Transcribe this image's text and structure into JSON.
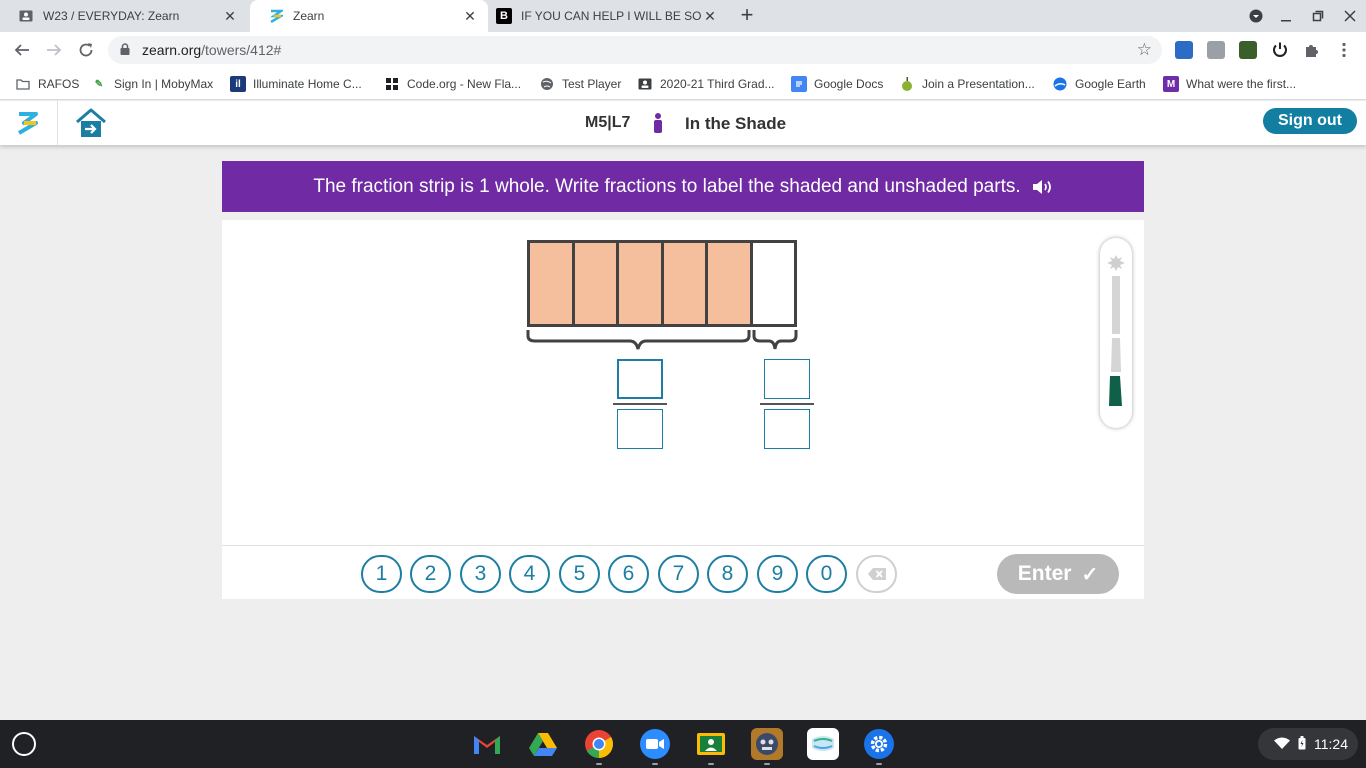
{
  "browser": {
    "tabs": [
      {
        "title": "W23 / EVERYDAY: Zearn",
        "active": false
      },
      {
        "title": "Zearn",
        "active": true
      },
      {
        "title": "IF YOU CAN HELP I WILL BE SO",
        "active": false
      }
    ],
    "address": {
      "host": "zearn.org",
      "path": "/towers/412#"
    },
    "bookmarks": [
      {
        "label": "RAFOS"
      },
      {
        "label": "Sign In | MobyMax"
      },
      {
        "label": "Illuminate Home C..."
      },
      {
        "label": "Code.org - New Fla..."
      },
      {
        "label": "Test Player"
      },
      {
        "label": "2020-21 Third Grad..."
      },
      {
        "label": "Google Docs"
      },
      {
        "label": "Join a Presentation..."
      },
      {
        "label": "Google Earth"
      },
      {
        "label": "What were the first..."
      }
    ]
  },
  "header": {
    "mission": "M5|L7",
    "lesson_title": "In the Shade",
    "sign_out": "Sign out",
    "colors": {
      "accent": "#117ea2",
      "banner": "#6f2aa4",
      "shade": "#f5bf9e"
    }
  },
  "prompt": {
    "text": "The fraction strip is 1 whole. Write fractions to label the shaded and unshaded parts."
  },
  "fraction_strip": {
    "total_parts": 6,
    "shaded_parts": 5,
    "answer_boxes": [
      {
        "group": "shaded",
        "numerator": "",
        "denominator": ""
      },
      {
        "group": "unshaded",
        "numerator": "",
        "denominator": ""
      }
    ]
  },
  "keypad": {
    "keys": [
      "1",
      "2",
      "3",
      "4",
      "5",
      "6",
      "7",
      "8",
      "9",
      "0"
    ],
    "enter_label": "Enter",
    "enter_check": "✓"
  },
  "system": {
    "time": "11:24"
  }
}
